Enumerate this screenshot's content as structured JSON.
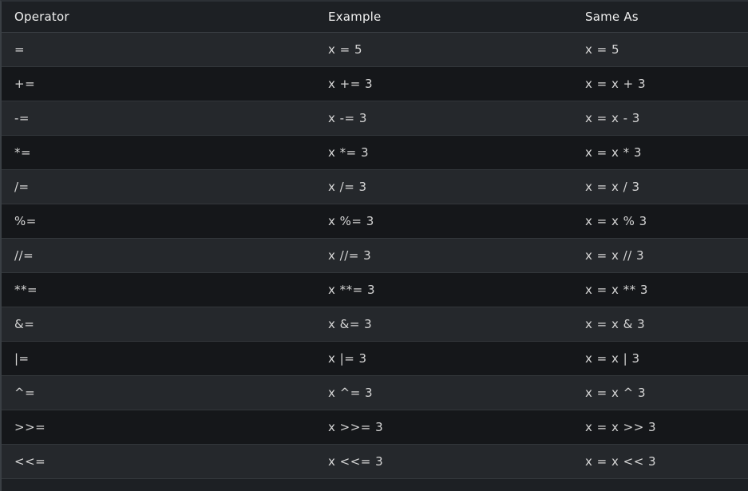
{
  "table": {
    "headers": [
      "Operator",
      "Example",
      "Same As"
    ],
    "rows": [
      [
        "=",
        "x = 5",
        "x = 5"
      ],
      [
        "+=",
        "x += 3",
        "x = x + 3"
      ],
      [
        "-=",
        "x -= 3",
        "x = x - 3"
      ],
      [
        "*=",
        "x *= 3",
        "x = x * 3"
      ],
      [
        "/=",
        "x /= 3",
        "x = x / 3"
      ],
      [
        "%=",
        "x %= 3",
        "x = x % 3"
      ],
      [
        "//=",
        "x //= 3",
        "x = x // 3"
      ],
      [
        "**=",
        "x **= 3",
        "x = x ** 3"
      ],
      [
        "&=",
        "x &= 3",
        "x = x & 3"
      ],
      [
        "|=",
        "x |= 3",
        "x = x | 3"
      ],
      [
        "^=",
        "x ^= 3",
        "x = x ^ 3"
      ],
      [
        ">>=",
        "x >>= 3",
        "x = x >> 3"
      ],
      [
        "<<=",
        "x <<= 3",
        "x = x << 3"
      ]
    ]
  }
}
